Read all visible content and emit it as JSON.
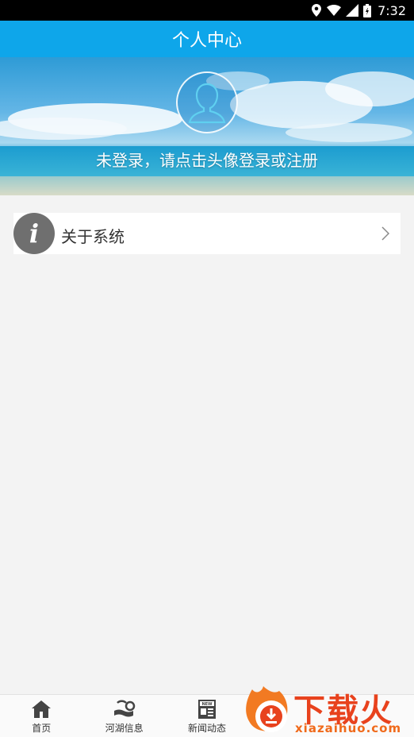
{
  "status_bar": {
    "time": "7:32"
  },
  "header": {
    "title": "个人中心"
  },
  "banner": {
    "login_prompt": "未登录，请点击头像登录或注册"
  },
  "menu": {
    "about_label": "关于系统"
  },
  "bottom_nav": {
    "items": [
      {
        "label": "首页",
        "icon": "home-icon"
      },
      {
        "label": "河湖信息",
        "icon": "river-icon"
      },
      {
        "label": "新闻动态",
        "icon": "news-icon"
      }
    ]
  },
  "watermark": {
    "cn": "下载火",
    "en": "xiazaihuo.com"
  },
  "colors": {
    "header": "#0ea6ea",
    "background": "#f3f3f3",
    "watermark": "#e8421d"
  }
}
